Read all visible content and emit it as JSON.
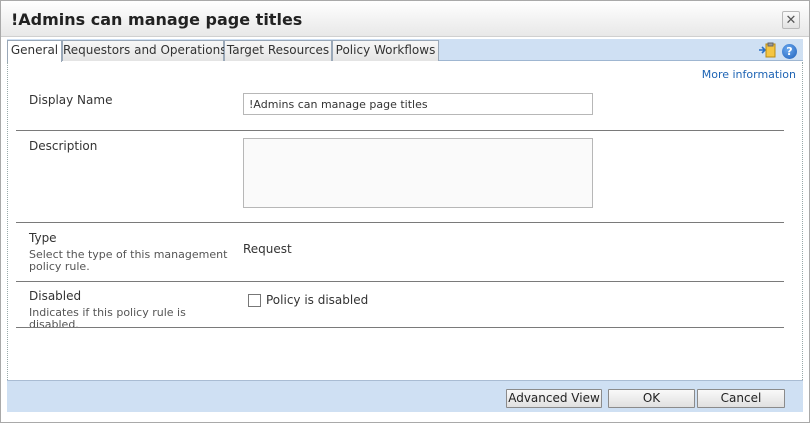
{
  "dialog": {
    "title": "!Admins can manage page titles"
  },
  "tabs": [
    {
      "label": "General"
    },
    {
      "label": "Requestors and Operations"
    },
    {
      "label": "Target Resources"
    },
    {
      "label": "Policy Workflows"
    }
  ],
  "toolbar_icons": [
    "pin-clipboard-icon",
    "help-icon"
  ],
  "more_information": "More information",
  "fields": {
    "display_name": {
      "label": "Display Name",
      "value": "!Admins can manage page titles"
    },
    "description": {
      "label": "Description",
      "value": ""
    },
    "type": {
      "label": "Type",
      "help": "Select the type of this management policy rule.",
      "value": "Request"
    },
    "disabled": {
      "label": "Disabled",
      "help": "Indicates if this policy rule is disabled.",
      "checkbox_label": "Policy is disabled",
      "checked": false
    }
  },
  "buttons": {
    "advanced_view": "Advanced View",
    "ok": "OK",
    "cancel": "Cancel"
  },
  "colors": {
    "tab_strip": "#cfe0f3",
    "link": "#1e64b4"
  }
}
